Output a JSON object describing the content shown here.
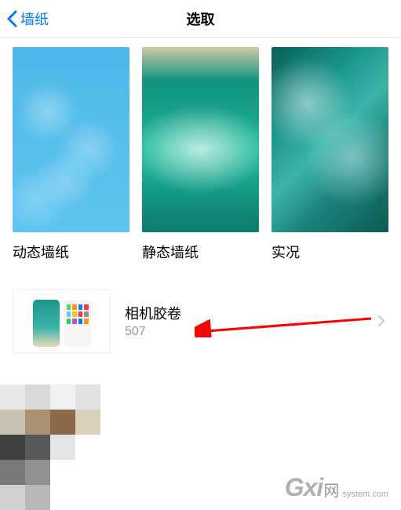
{
  "header": {
    "back_label": "墙纸",
    "title": "选取"
  },
  "categories": [
    {
      "label": "动态墙纸"
    },
    {
      "label": "静态墙纸"
    },
    {
      "label": "实况"
    }
  ],
  "album": {
    "name": "相机胶卷",
    "count": "507"
  },
  "watermark": {
    "prefix": "Gxi",
    "cn": "网",
    "domain": "system.com"
  }
}
